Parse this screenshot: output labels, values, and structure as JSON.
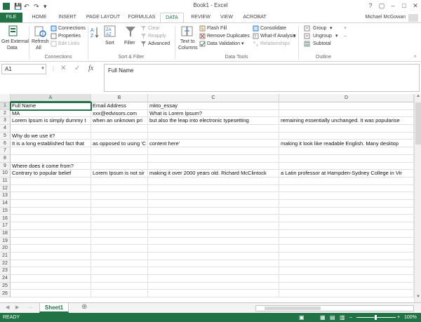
{
  "window": {
    "title": "Book1 - Excel",
    "help": "?",
    "restore": "▢",
    "minimize": "–",
    "maximize": "□",
    "close": "✕"
  },
  "tabs": [
    "FILE",
    "HOME",
    "INSERT",
    "PAGE LAYOUT",
    "FORMULAS",
    "DATA",
    "REVIEW",
    "VIEW",
    "ACROBAT"
  ],
  "active_tab": "DATA",
  "user": "Michael McGowan",
  "ribbon": {
    "get_external": "Get External",
    "get_external2": "Data",
    "refresh": "Refresh",
    "refresh2": "All",
    "connections": "Connections",
    "properties": "Properties",
    "edit_links": "Edit Links",
    "group_connections": "Connections",
    "sort": "Sort",
    "filter": "Filter",
    "clear": "Clear",
    "reapply": "Reapply",
    "advanced": "Advanced",
    "group_sortfilter": "Sort & Filter",
    "text_to": "Text to",
    "columns": "Columns",
    "flash_fill": "Flash Fill",
    "remove_dup": "Remove Duplicates",
    "data_validation": "Data Validation",
    "consolidate": "Consolidate",
    "whatif": "What-If Analysis",
    "relationships": "Relationships",
    "group_datatools": "Data Tools",
    "group_btn": "Group",
    "ungroup": "Ungroup",
    "subtotal": "Subtotal",
    "group_outline": "Outline"
  },
  "formula_bar": {
    "name_box": "A1",
    "fx": "fx",
    "content": "Full Name"
  },
  "columns": [
    "A",
    "B",
    "C",
    "D"
  ],
  "rows": [
    "1",
    "2",
    "3",
    "4",
    "5",
    "6",
    "7",
    "8",
    "9",
    "10",
    "11",
    "12",
    "13",
    "14",
    "15",
    "16",
    "17",
    "18",
    "19",
    "20",
    "21",
    "22",
    "23",
    "24",
    "25",
    "26"
  ],
  "cells": [
    [
      "Full Name",
      "Email Address",
      "mkto_essay",
      ""
    ],
    [
      "MA",
      "xxx@edvisors.com",
      "What is Lorem Ipsum?",
      ""
    ],
    [
      "Lorem Ipsum is simply dummy t",
      "when an unknown pri",
      "but also the leap into electronic typesetting",
      "remaining essentially unchanged. It was popularise"
    ],
    [
      "",
      "",
      "",
      ""
    ],
    [
      "Why do we use it?",
      "",
      "",
      ""
    ],
    [
      "It is a long established fact that",
      "as opposed to using 'C",
      "content here'",
      "making it look like readable English. Many desktop"
    ],
    [
      "",
      "",
      "",
      ""
    ],
    [
      "",
      "",
      "",
      ""
    ],
    [
      "Where does it come from?",
      "",
      "",
      ""
    ],
    [
      "Contrary to popular belief",
      "Lorem Ipsum is not sir",
      "making it over 2000 years old. Richard McClintock",
      "a Latin professor at Hampden-Sydney College in Vir"
    ]
  ],
  "sheets": {
    "name": "Sheet1",
    "add": "⊕"
  },
  "status": {
    "text": "READY",
    "zoom": "100%"
  },
  "accent_color": "#217346"
}
